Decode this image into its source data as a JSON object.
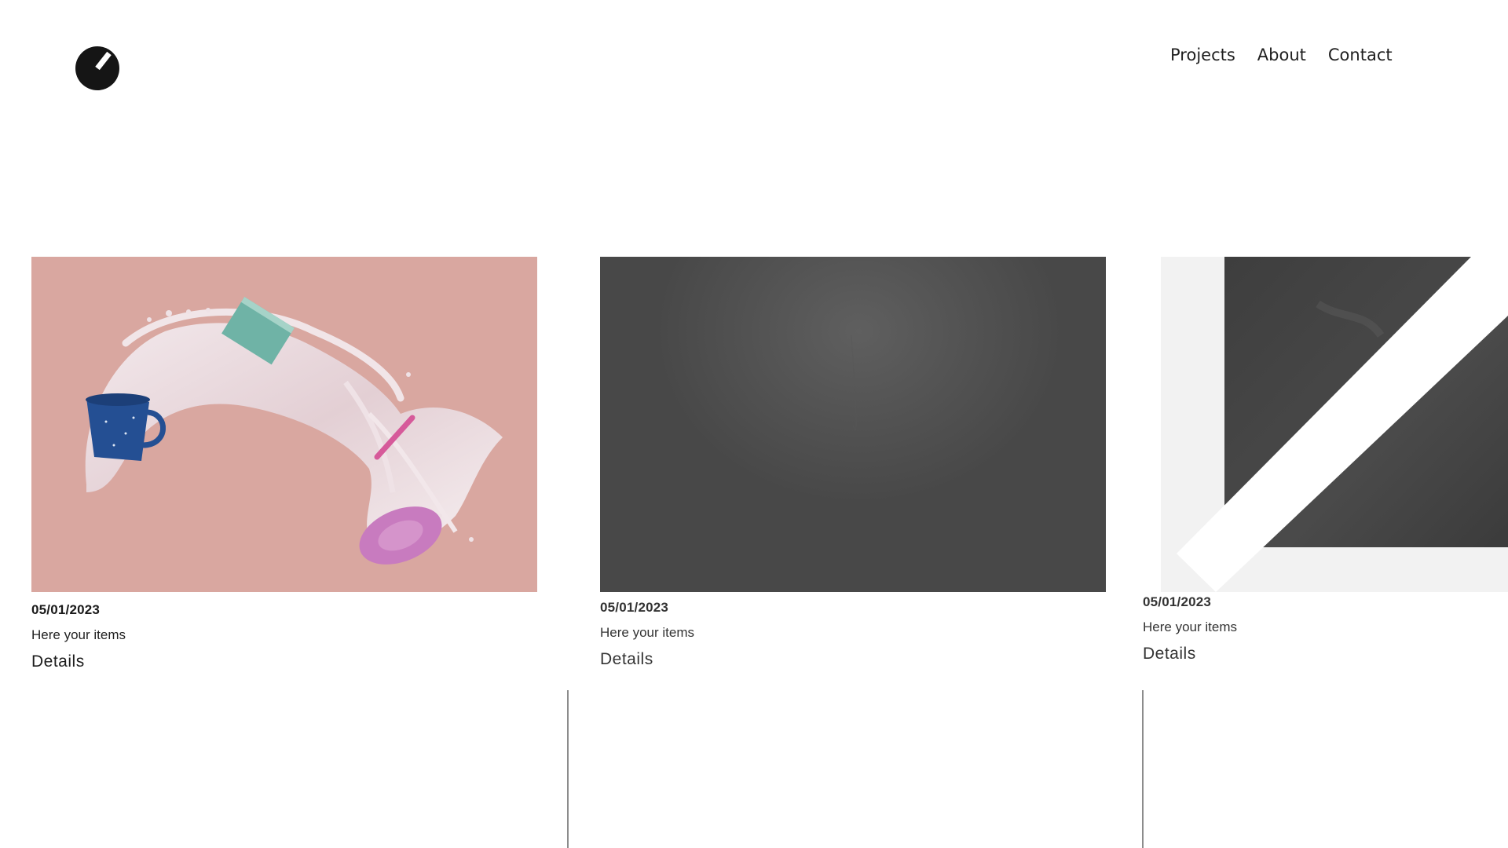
{
  "nav": {
    "items": [
      "Projects",
      "About",
      "Contact"
    ]
  },
  "logo": {
    "icon": "logo-icon"
  },
  "cards": [
    {
      "date": "05/01/2023",
      "description": "Here your items",
      "details_label": "Details",
      "image": "milk-splash-cup-image"
    },
    {
      "date": "05/01/2023",
      "description": "Here your items",
      "details_label": "Details",
      "image": "dark-gray-gradient-image"
    },
    {
      "date": "05/01/2023",
      "description": "Here your items",
      "details_label": "Details",
      "image": "slate-white-stripe-image"
    }
  ],
  "colors": {
    "card1_bg": "#d9a7a0",
    "card2_bg": "#4d4d4d",
    "card3_bg": "#f2f2f2",
    "divider": "#8c8c8c"
  }
}
